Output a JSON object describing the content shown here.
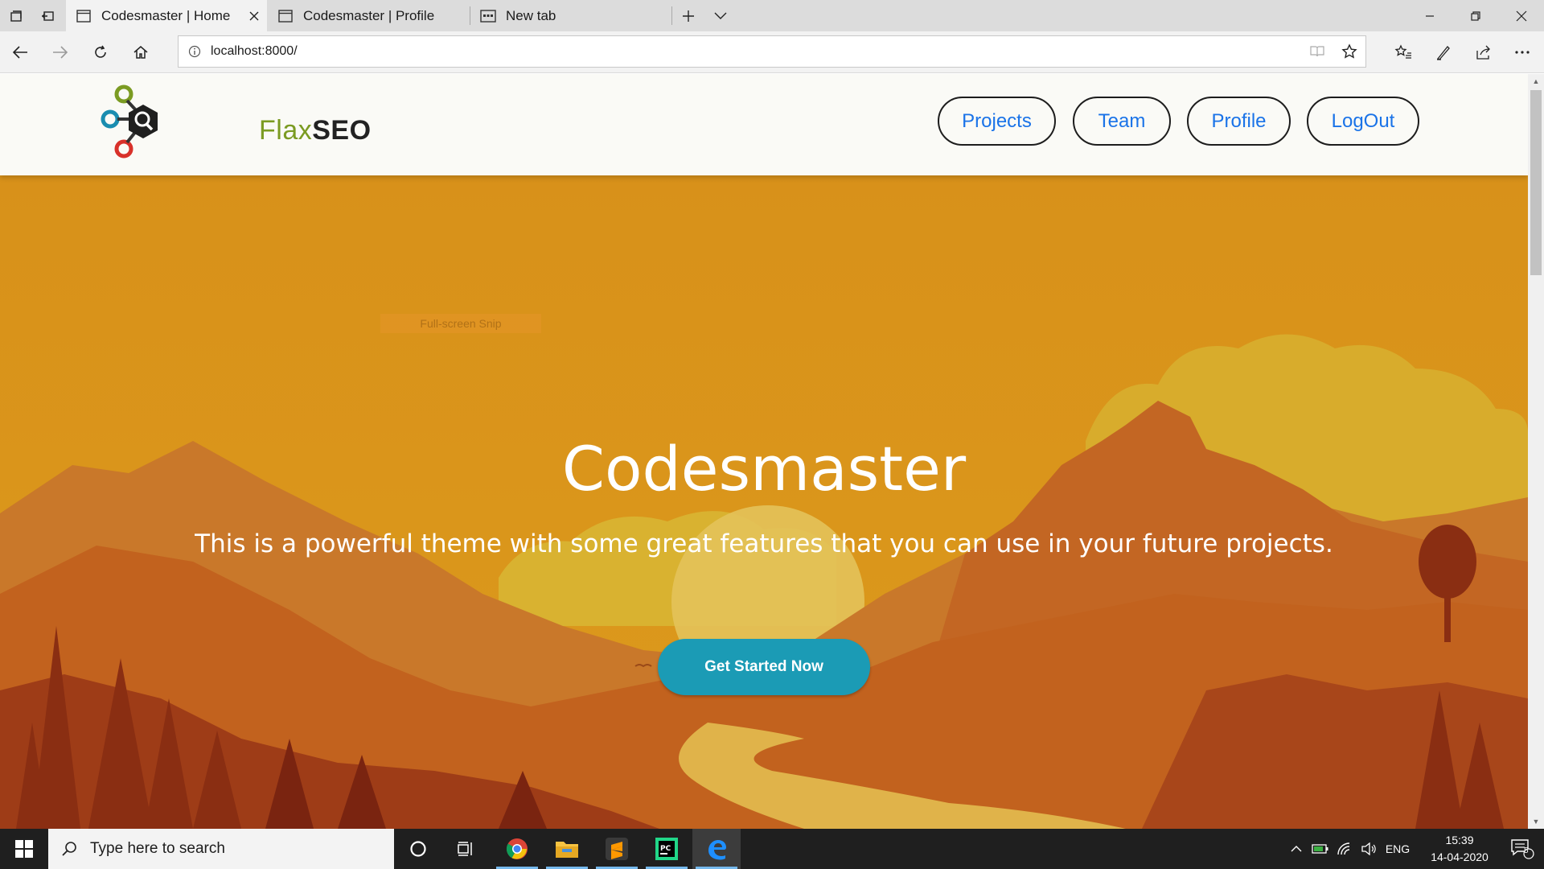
{
  "browser": {
    "tabs": [
      {
        "title": "Codesmaster | Home",
        "active": true
      },
      {
        "title": "Codesmaster | Profile",
        "active": false
      },
      {
        "title": "New tab",
        "active": false
      }
    ],
    "address": "localhost:8000/"
  },
  "site": {
    "logo": {
      "part1": "Flax",
      "part2": "SEO"
    },
    "nav": [
      {
        "label": "Projects"
      },
      {
        "label": "Team"
      },
      {
        "label": "Profile"
      },
      {
        "label": "LogOut"
      }
    ],
    "hero": {
      "title": "Codesmaster",
      "subtitle": "This is a powerful theme with some great features that you can use in your future projects.",
      "cta": "Get Started Now",
      "snip_hint": "Full-screen Snip"
    }
  },
  "taskbar": {
    "search_placeholder": "Type here to search",
    "language": "ENG",
    "time": "15:39",
    "date": "14-04-2020",
    "notification_count": "5"
  },
  "colors": {
    "hero_sky": "#da9216",
    "cta": "#1b9bb5",
    "nav_text": "#1a73e8",
    "taskbar": "#1f1f1f"
  }
}
